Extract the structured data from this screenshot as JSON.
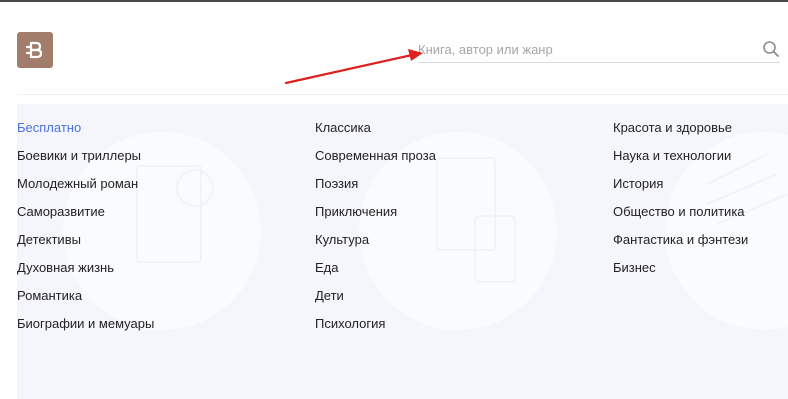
{
  "search": {
    "placeholder": "Книга, автор или жанр",
    "icon": "search-icon"
  },
  "logo": {
    "icon": "bookmate-logo-icon",
    "color": "#a27d6b"
  },
  "accent_color": "#4a72d9",
  "annotation_color": "#e02020",
  "genres": {
    "column1": [
      "Бесплатно",
      "Боевики и триллеры",
      "Молодежный роман",
      "Саморазвитие",
      "Детективы",
      "Духовная жизнь",
      "Романтика",
      "Биографии и мемуары"
    ],
    "column2": [
      "Классика",
      "Современная проза",
      "Поэзия",
      "Приключения",
      "Культура",
      "Еда",
      "Дети",
      "Психология"
    ],
    "column3": [
      "Красота и здоровье",
      "Наука и технологии",
      "История",
      "Общество и политика",
      "Фантастика и фэнтези",
      "Бизнес"
    ]
  }
}
